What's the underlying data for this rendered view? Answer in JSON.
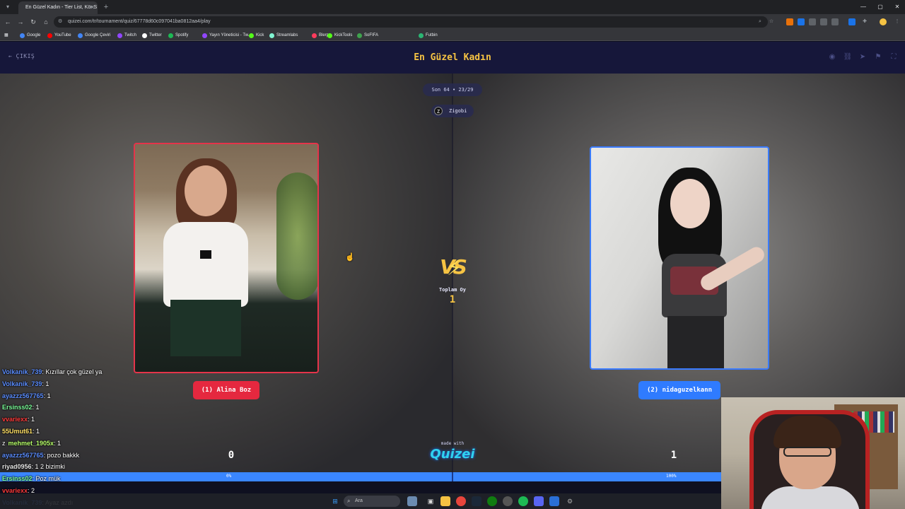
{
  "browser": {
    "tab_title": "En Güzel Kadın - Tier List, Kör S",
    "url": "quizei.com/tr/tournament/quiz/67778d60c097041ba0812aa4/play",
    "bookmarks": [
      {
        "label": "Google",
        "color": "#4285f4"
      },
      {
        "label": "YouTube",
        "color": "#ff0000"
      },
      {
        "label": "Google Çeviri",
        "color": "#4285f4"
      },
      {
        "label": "Twitch",
        "color": "#9146ff"
      },
      {
        "label": "Twitter",
        "color": "#ffffff"
      },
      {
        "label": "Spotify",
        "color": "#1db954"
      },
      {
        "label": "Yayın Yöneticisi - Tw...",
        "color": "#9146ff"
      },
      {
        "label": "Kick",
        "color": "#53fc18"
      },
      {
        "label": "Streamlabs",
        "color": "#80f5d2"
      },
      {
        "label": "Blerp",
        "color": "#ff3b5c"
      },
      {
        "label": "KickTools",
        "color": "#53fc18"
      },
      {
        "label": "SoFIFA",
        "color": "#3fa34d"
      },
      {
        "label": "Futbin",
        "color": "#2bb673"
      }
    ]
  },
  "app": {
    "exit_label": "ÇIKIŞ",
    "title": "En Güzel Kadın",
    "round_label": "Son 64 • 23/29",
    "user_initial": "Z",
    "username": "Zigobi",
    "left": {
      "name": "(1) Alina Boz",
      "score": "0",
      "percent": "0%",
      "percent_value": 0
    },
    "right": {
      "name": "(2) nidaguzelkann",
      "score": "1",
      "percent": "100%",
      "percent_value": 100
    },
    "vs_label": "VS",
    "total_label": "Toplam Oy",
    "total_value": "1",
    "made_with": "made with",
    "logo": "Quizei",
    "colors": {
      "accent": "#f6c343",
      "left": "#e5283f",
      "right": "#2f7bff",
      "header_bg": "#16173a"
    }
  },
  "chat": [
    {
      "user": "Volkanik_739",
      "color": "#5b8dff",
      "msg": ": Kızıllar çok güzel ya"
    },
    {
      "user": "Volkanik_739",
      "color": "#5b8dff",
      "msg": ": 1"
    },
    {
      "user": "ayazzz567765",
      "color": "#5b8dff",
      "msg": ": 1"
    },
    {
      "user": "Ersinss02",
      "color": "#7cff9a",
      "msg": ": 1"
    },
    {
      "user": "vvariexx",
      "color": "#ff3b3b",
      "msg": ": 1"
    },
    {
      "user": "55Umut61",
      "color": "#ffe066",
      "msg": ": 1"
    },
    {
      "user": "mehmet_1905x",
      "color": "#b7ff6a",
      "msg": ": 1",
      "badge": "z"
    },
    {
      "user": "ayazzz567765",
      "color": "#5b8dff",
      "msg": ": pozo bakkk"
    },
    {
      "user": "riyad0956",
      "color": "#e6e6e6",
      "msg": ": 1 2 bizimki"
    },
    {
      "user": "Ersinss02",
      "color": "#7cff9a",
      "msg": ": Poz mük"
    },
    {
      "user": "vvariexx",
      "color": "#ff3b3b",
      "msg": ": 2"
    },
    {
      "user": "Volkanik_739",
      "color": "#5b8dff",
      "msg": ": Ayaz azdı"
    }
  ],
  "taskbar": {
    "search_label": "Ara"
  }
}
